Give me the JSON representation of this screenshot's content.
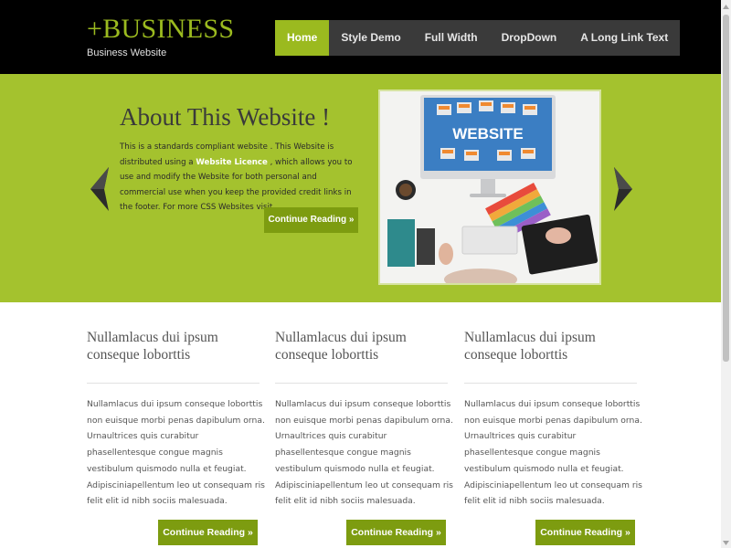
{
  "header": {
    "logo_title": "+BUSINESS",
    "logo_subtitle": "Business Website"
  },
  "nav": {
    "items": [
      {
        "label": "Home",
        "active": true
      },
      {
        "label": "Style Demo",
        "active": false
      },
      {
        "label": "Full Width",
        "active": false
      },
      {
        "label": "DropDown",
        "active": false
      },
      {
        "label": "A Long Link Text",
        "active": false
      }
    ]
  },
  "hero": {
    "title": "About This Website !",
    "text_before": "This is a standards compliant website . This Website is distributed using a ",
    "link_text": "Website Licence",
    "text_after": " , which allows you to use and modify the Website for both personal and commercial use when you keep the provided credit links in the footer. For more CSS Websites visit .",
    "button_label": "Continue Reading »",
    "image_label": "WEBSITE"
  },
  "columns": [
    {
      "title": "Nullamlacus dui ipsum conseque loborttis",
      "text": "Nullamlacus dui ipsum conseque loborttis non euisque morbi penas dapibulum orna. Urnaultrices quis curabitur phasellentesque congue magnis vestibulum quismodo nulla et feugiat. Adipisciniapellentum leo ut consequam ris felit elit id nibh sociis malesuada.",
      "button_label": "Continue Reading »"
    },
    {
      "title": "Nullamlacus dui ipsum conseque loborttis",
      "text": "Nullamlacus dui ipsum conseque loborttis non euisque morbi penas dapibulum orna. Urnaultrices quis curabitur phasellentesque congue magnis vestibulum quismodo nulla et feugiat. Adipisciniapellentum leo ut consequam ris felit elit id nibh sociis malesuada.",
      "button_label": "Continue Reading »"
    },
    {
      "title": "Nullamlacus dui ipsum conseque loborttis",
      "text": "Nullamlacus dui ipsum conseque loborttis non euisque morbi penas dapibulum orna. Urnaultrices quis curabitur phasellentesque congue magnis vestibulum quismodo nulla et feugiat. Adipisciniapellentum leo ut consequam ris felit elit id nibh sociis malesuada.",
      "button_label": "Continue Reading »"
    }
  ],
  "colors": {
    "accent": "#9bba1f",
    "hero_bg": "#a4c22e",
    "button_bg": "#7d9c10",
    "header_bg": "#000000"
  }
}
